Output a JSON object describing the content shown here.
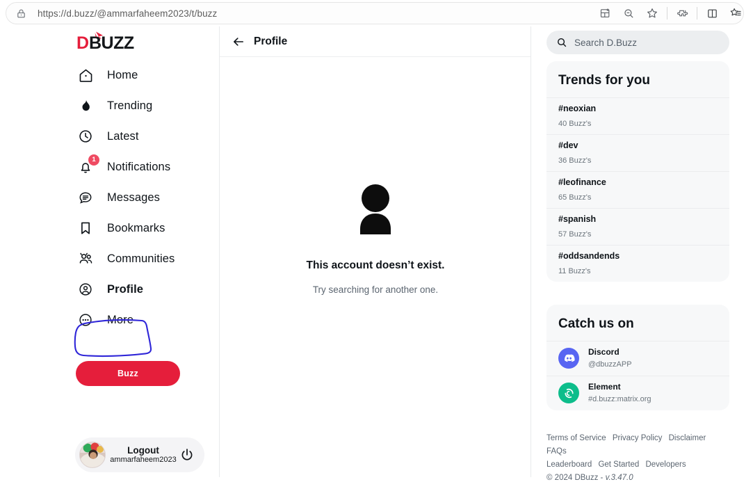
{
  "browser": {
    "url": "https://d.buzz/@ammarfaheem2023/t/buzz",
    "lock_icon": "lock-icon",
    "toolbar_icons": [
      {
        "name": "split-screen-add-icon"
      },
      {
        "name": "zoom-out-icon"
      },
      {
        "name": "bookmark-star-icon"
      },
      {
        "name": "extensions-puzzle-icon"
      },
      {
        "name": "split-view-icon"
      },
      {
        "name": "favorites-list-icon"
      }
    ]
  },
  "brand": {
    "logo_d": "D",
    "logo_rest": "BUZZ",
    "accent_red": "#e51e3b",
    "logo_dark": "#14171a"
  },
  "sidebar": {
    "items": [
      {
        "label": "Home",
        "icon": "home-icon",
        "active": false,
        "badge": ""
      },
      {
        "label": "Trending",
        "icon": "flame-icon",
        "active": false,
        "badge": ""
      },
      {
        "label": "Latest",
        "icon": "clock-icon",
        "active": false,
        "badge": ""
      },
      {
        "label": "Notifications",
        "icon": "bell-icon",
        "active": false,
        "badge": "1"
      },
      {
        "label": "Messages",
        "icon": "message-icon",
        "active": false,
        "badge": ""
      },
      {
        "label": "Bookmarks",
        "icon": "bookmark-icon",
        "active": false,
        "badge": ""
      },
      {
        "label": "Communities",
        "icon": "communities-icon",
        "active": false,
        "badge": ""
      },
      {
        "label": "Profile",
        "icon": "profile-icon",
        "active": true,
        "badge": ""
      },
      {
        "label": "More",
        "icon": "more-dots-icon",
        "active": false,
        "badge": ""
      }
    ],
    "buzz_button": "Buzz",
    "annotation_color": "#2f26d8",
    "user": {
      "logout_label": "Logout",
      "username": "ammarfaheem2023",
      "power_icon": "power-icon",
      "avatar": "avatar"
    }
  },
  "main": {
    "back_icon": "back-arrow-icon",
    "title": "Profile",
    "empty_state": {
      "icon": "person-placeholder-icon",
      "title": "This account doesn’t exist.",
      "subtitle": "Try searching for another one."
    }
  },
  "right": {
    "search": {
      "icon": "search-icon",
      "placeholder": "Search D.Buzz",
      "value": ""
    },
    "trends": {
      "title": "Trends for you",
      "items": [
        {
          "tag": "#neoxian",
          "count": "40 Buzz's"
        },
        {
          "tag": "#dev",
          "count": "36 Buzz's"
        },
        {
          "tag": "#leofinance",
          "count": "65 Buzz's"
        },
        {
          "tag": "#spanish",
          "count": "57 Buzz's"
        },
        {
          "tag": "#oddsandends",
          "count": "11 Buzz's"
        }
      ]
    },
    "catch_us_on": {
      "title": "Catch us on",
      "items": [
        {
          "name": "Discord",
          "handle": "@dbuzzAPP",
          "icon": "discord-icon",
          "color": "#5865f2"
        },
        {
          "name": "Element",
          "handle": "#d.buzz:matrix.org",
          "icon": "element-icon",
          "color": "#0dbd8b"
        }
      ]
    },
    "footer": {
      "links_row1": [
        "Terms of Service",
        "Privacy Policy",
        "Disclaimer",
        "FAQs"
      ],
      "links_row2": [
        "Leaderboard",
        "Get Started",
        "Developers"
      ],
      "copyright": "© 2024 DBuzz",
      "separator": "-",
      "version": "v.3.47.0"
    }
  }
}
